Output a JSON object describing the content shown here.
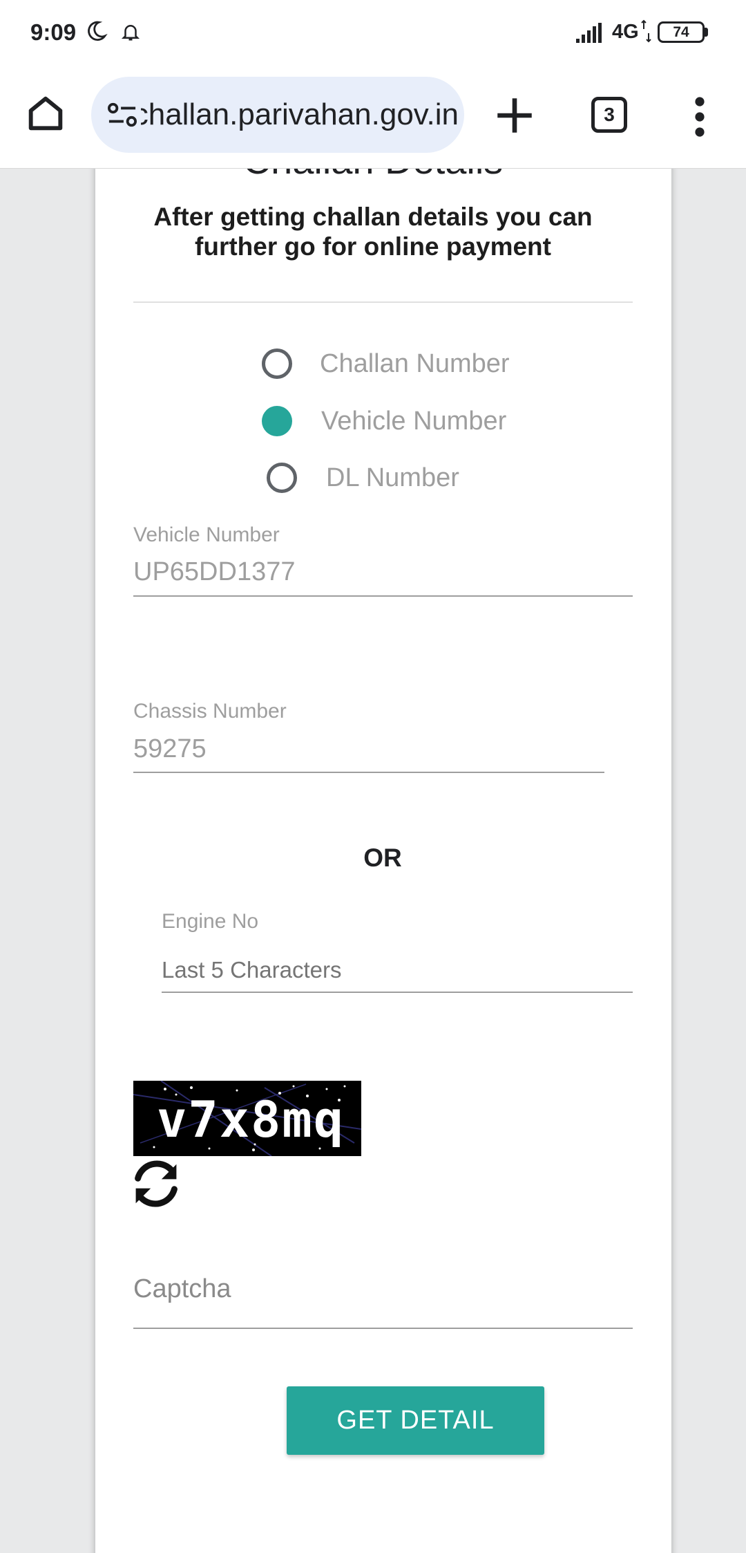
{
  "status_bar": {
    "time": "9:09",
    "network": "4G",
    "battery": "74"
  },
  "browser": {
    "url": "challan.parivahan.gov.in",
    "tab_count": "3"
  },
  "page": {
    "title": "Challan Details",
    "subtitle": "After getting challan details you can further go for online payment",
    "search_options": [
      {
        "label": "Challan Number",
        "selected": false
      },
      {
        "label": "Vehicle Number",
        "selected": true
      },
      {
        "label": "DL Number",
        "selected": false
      }
    ],
    "vehicle_number": {
      "label": "Vehicle Number",
      "value": "UP65DD1377"
    },
    "chassis_number": {
      "label": "Chassis Number",
      "value": "59275"
    },
    "or_label": "OR",
    "engine_no": {
      "label": "Engine No",
      "placeholder": "Last 5 Characters"
    },
    "captcha": {
      "image_text": "v7x8mq",
      "placeholder": "Captcha"
    },
    "submit_label": "GET DETAIL"
  },
  "colors": {
    "accent": "#26a69a",
    "pill": "#e8eefa",
    "background": "#e8e9ea"
  },
  "icons": [
    "moon-icon",
    "bell-icon",
    "signal-icon",
    "home-icon",
    "site-info-icon",
    "plus-icon",
    "more-vert-icon",
    "refresh-icon"
  ]
}
